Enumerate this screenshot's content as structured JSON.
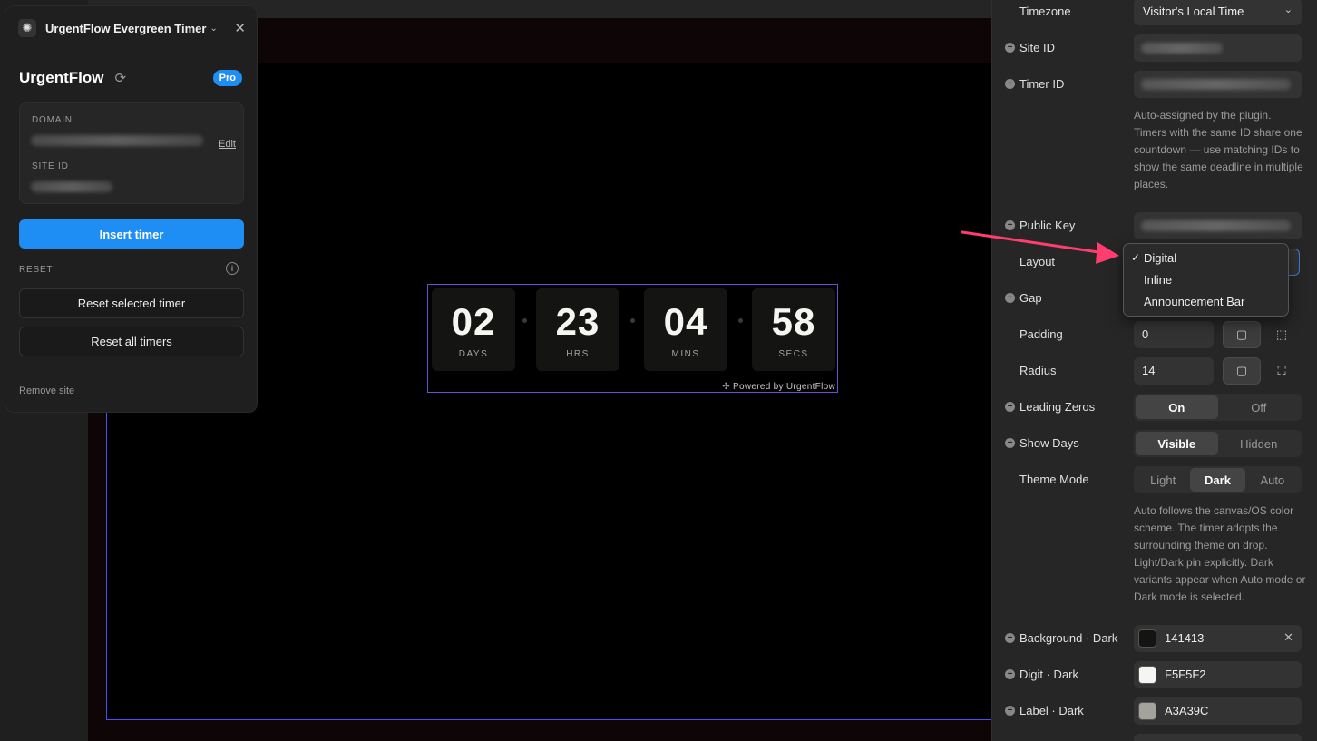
{
  "plugin_panel": {
    "title": "UrgentFlow Evergreen Timer",
    "brand": "UrgentFlow",
    "badge": "Pro",
    "domain_label": "DOMAIN",
    "edit_label": "Edit",
    "site_id_label": "SITE ID",
    "insert_button": "Insert timer",
    "reset_section_label": "RESET",
    "reset_selected_button": "Reset selected timer",
    "reset_all_button": "Reset all timers",
    "remove_site_link": "Remove site"
  },
  "timer": {
    "units": [
      {
        "value": "02",
        "label": "DAYS"
      },
      {
        "value": "23",
        "label": "HRS"
      },
      {
        "value": "04",
        "label": "MINS"
      },
      {
        "value": "58",
        "label": "SECS"
      }
    ],
    "powered_by": "Powered by UrgentFlow"
  },
  "properties": {
    "timezone": {
      "label": "Timezone",
      "value": "Visitor's Local Time"
    },
    "site_id": {
      "label": "Site ID"
    },
    "timer_id": {
      "label": "Timer ID"
    },
    "timer_id_help": "Auto-assigned by the plugin. Timers with the same ID share one countdown — use matching IDs to show the same deadline in multiple places.",
    "public_key": {
      "label": "Public Key"
    },
    "layout": {
      "label": "Layout"
    },
    "gap": {
      "label": "Gap"
    },
    "padding": {
      "label": "Padding",
      "value": "0"
    },
    "radius": {
      "label": "Radius",
      "value": "14"
    },
    "leading_zeros": {
      "label": "Leading Zeros",
      "options": [
        "On",
        "Off"
      ],
      "selected": "On"
    },
    "show_days": {
      "label": "Show Days",
      "options": [
        "Visible",
        "Hidden"
      ],
      "selected": "Visible"
    },
    "theme_mode": {
      "label": "Theme Mode",
      "options": [
        "Light",
        "Dark",
        "Auto"
      ],
      "selected": "Dark"
    },
    "theme_help": "Auto follows the canvas/OS color scheme. The timer adopts the surrounding theme on drop. Light/Dark pin explicitly. Dark variants appear when Auto mode or Dark mode is selected.",
    "background_dark": {
      "label": "Background · Dark",
      "value": "141413",
      "color": "#141413"
    },
    "digit_dark": {
      "label": "Digit · Dark",
      "value": "F5F5F2",
      "color": "#F5F5F2"
    },
    "label_dark": {
      "label": "Label · Dark",
      "value": "A3A39C",
      "color": "#A3A39C"
    }
  },
  "layout_dropdown": {
    "options": [
      "Digital",
      "Inline",
      "Announcement Bar"
    ],
    "selected": "Digital"
  },
  "colors": {
    "accent": "#1e8ef5",
    "annotation_arrow": "#ff3d6e"
  }
}
